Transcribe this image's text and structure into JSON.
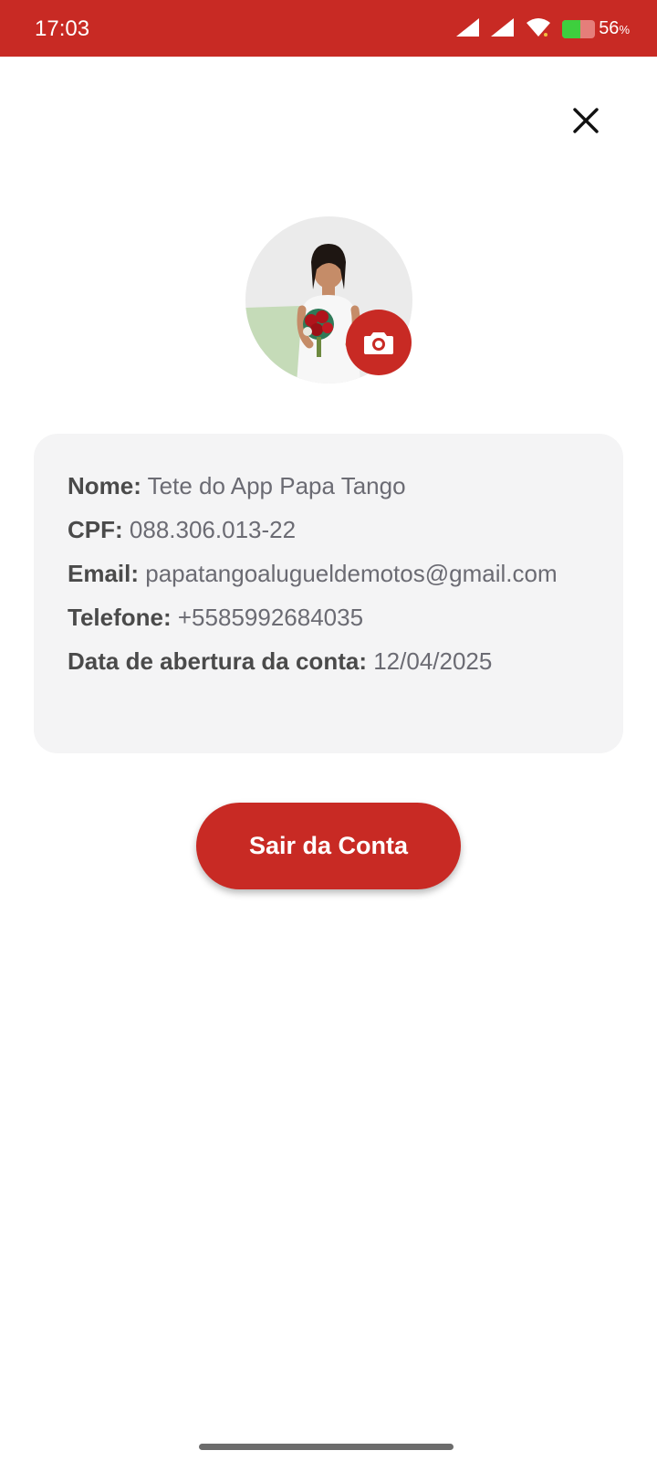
{
  "status_bar": {
    "time": "17:03",
    "battery_percent": "56",
    "battery_unit": "%",
    "battery_level": 0.56,
    "icons": [
      "signal-icon",
      "signal-icon",
      "wifi-icon",
      "battery-icon"
    ]
  },
  "colors": {
    "brand_red": "#c82a24",
    "card_bg": "#f4f4f5",
    "label_text": "#4a4a4a",
    "value_text": "#6b6b73"
  },
  "profile": {
    "avatar_icon": "profile-photo",
    "camera_icon": "camera-icon",
    "fields": [
      {
        "label": "Nome:",
        "value": "Tete do App Papa Tango"
      },
      {
        "label": "CPF:",
        "value": "088.306.013-22"
      },
      {
        "label": "Email:",
        "value": "papatangoalugueldemotos@gmail.com"
      },
      {
        "label": "Telefone:",
        "value": "+5585992684035"
      },
      {
        "label": "Data de abertura da conta:",
        "value": "12/04/2025"
      }
    ]
  },
  "actions": {
    "close_icon": "close-icon",
    "logout_label": "Sair da Conta"
  }
}
